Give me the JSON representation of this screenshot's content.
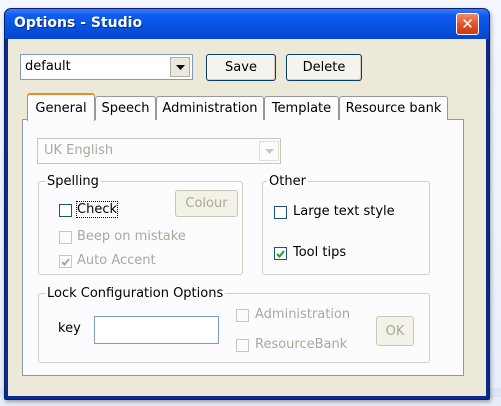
{
  "window": {
    "title": "Options - Studio",
    "close_label": "✕"
  },
  "profile": {
    "selected": "default",
    "save_label": "Save",
    "delete_label": "Delete"
  },
  "tabs": [
    {
      "label": "General",
      "active": true
    },
    {
      "label": "Speech"
    },
    {
      "label": "Administration"
    },
    {
      "label": "Template"
    },
    {
      "label": "Resource bank"
    }
  ],
  "general": {
    "language": "UK English",
    "spelling": {
      "title": "Spelling",
      "check_label": "Check",
      "check_checked": false,
      "colour_label": "Colour",
      "beep_label": "Beep on mistake",
      "beep_checked": false,
      "accent_label": "Auto Accent",
      "accent_checked": true
    },
    "other": {
      "title": "Other",
      "large_text_label": "Large text style",
      "large_text_checked": false,
      "tooltips_label": "Tool tips",
      "tooltips_checked": true
    },
    "lock": {
      "title": "Lock Configuration Options",
      "key_label": "key",
      "key_value": "",
      "admin_label": "Administration",
      "resourcebank_label": "ResourceBank",
      "ok_label": "OK"
    }
  },
  "colors": {
    "title_bar": "#0753e3",
    "dialog_face": "#ece9d8",
    "tab_highlight": "#e68b2c",
    "disabled_text": "#aca899"
  }
}
